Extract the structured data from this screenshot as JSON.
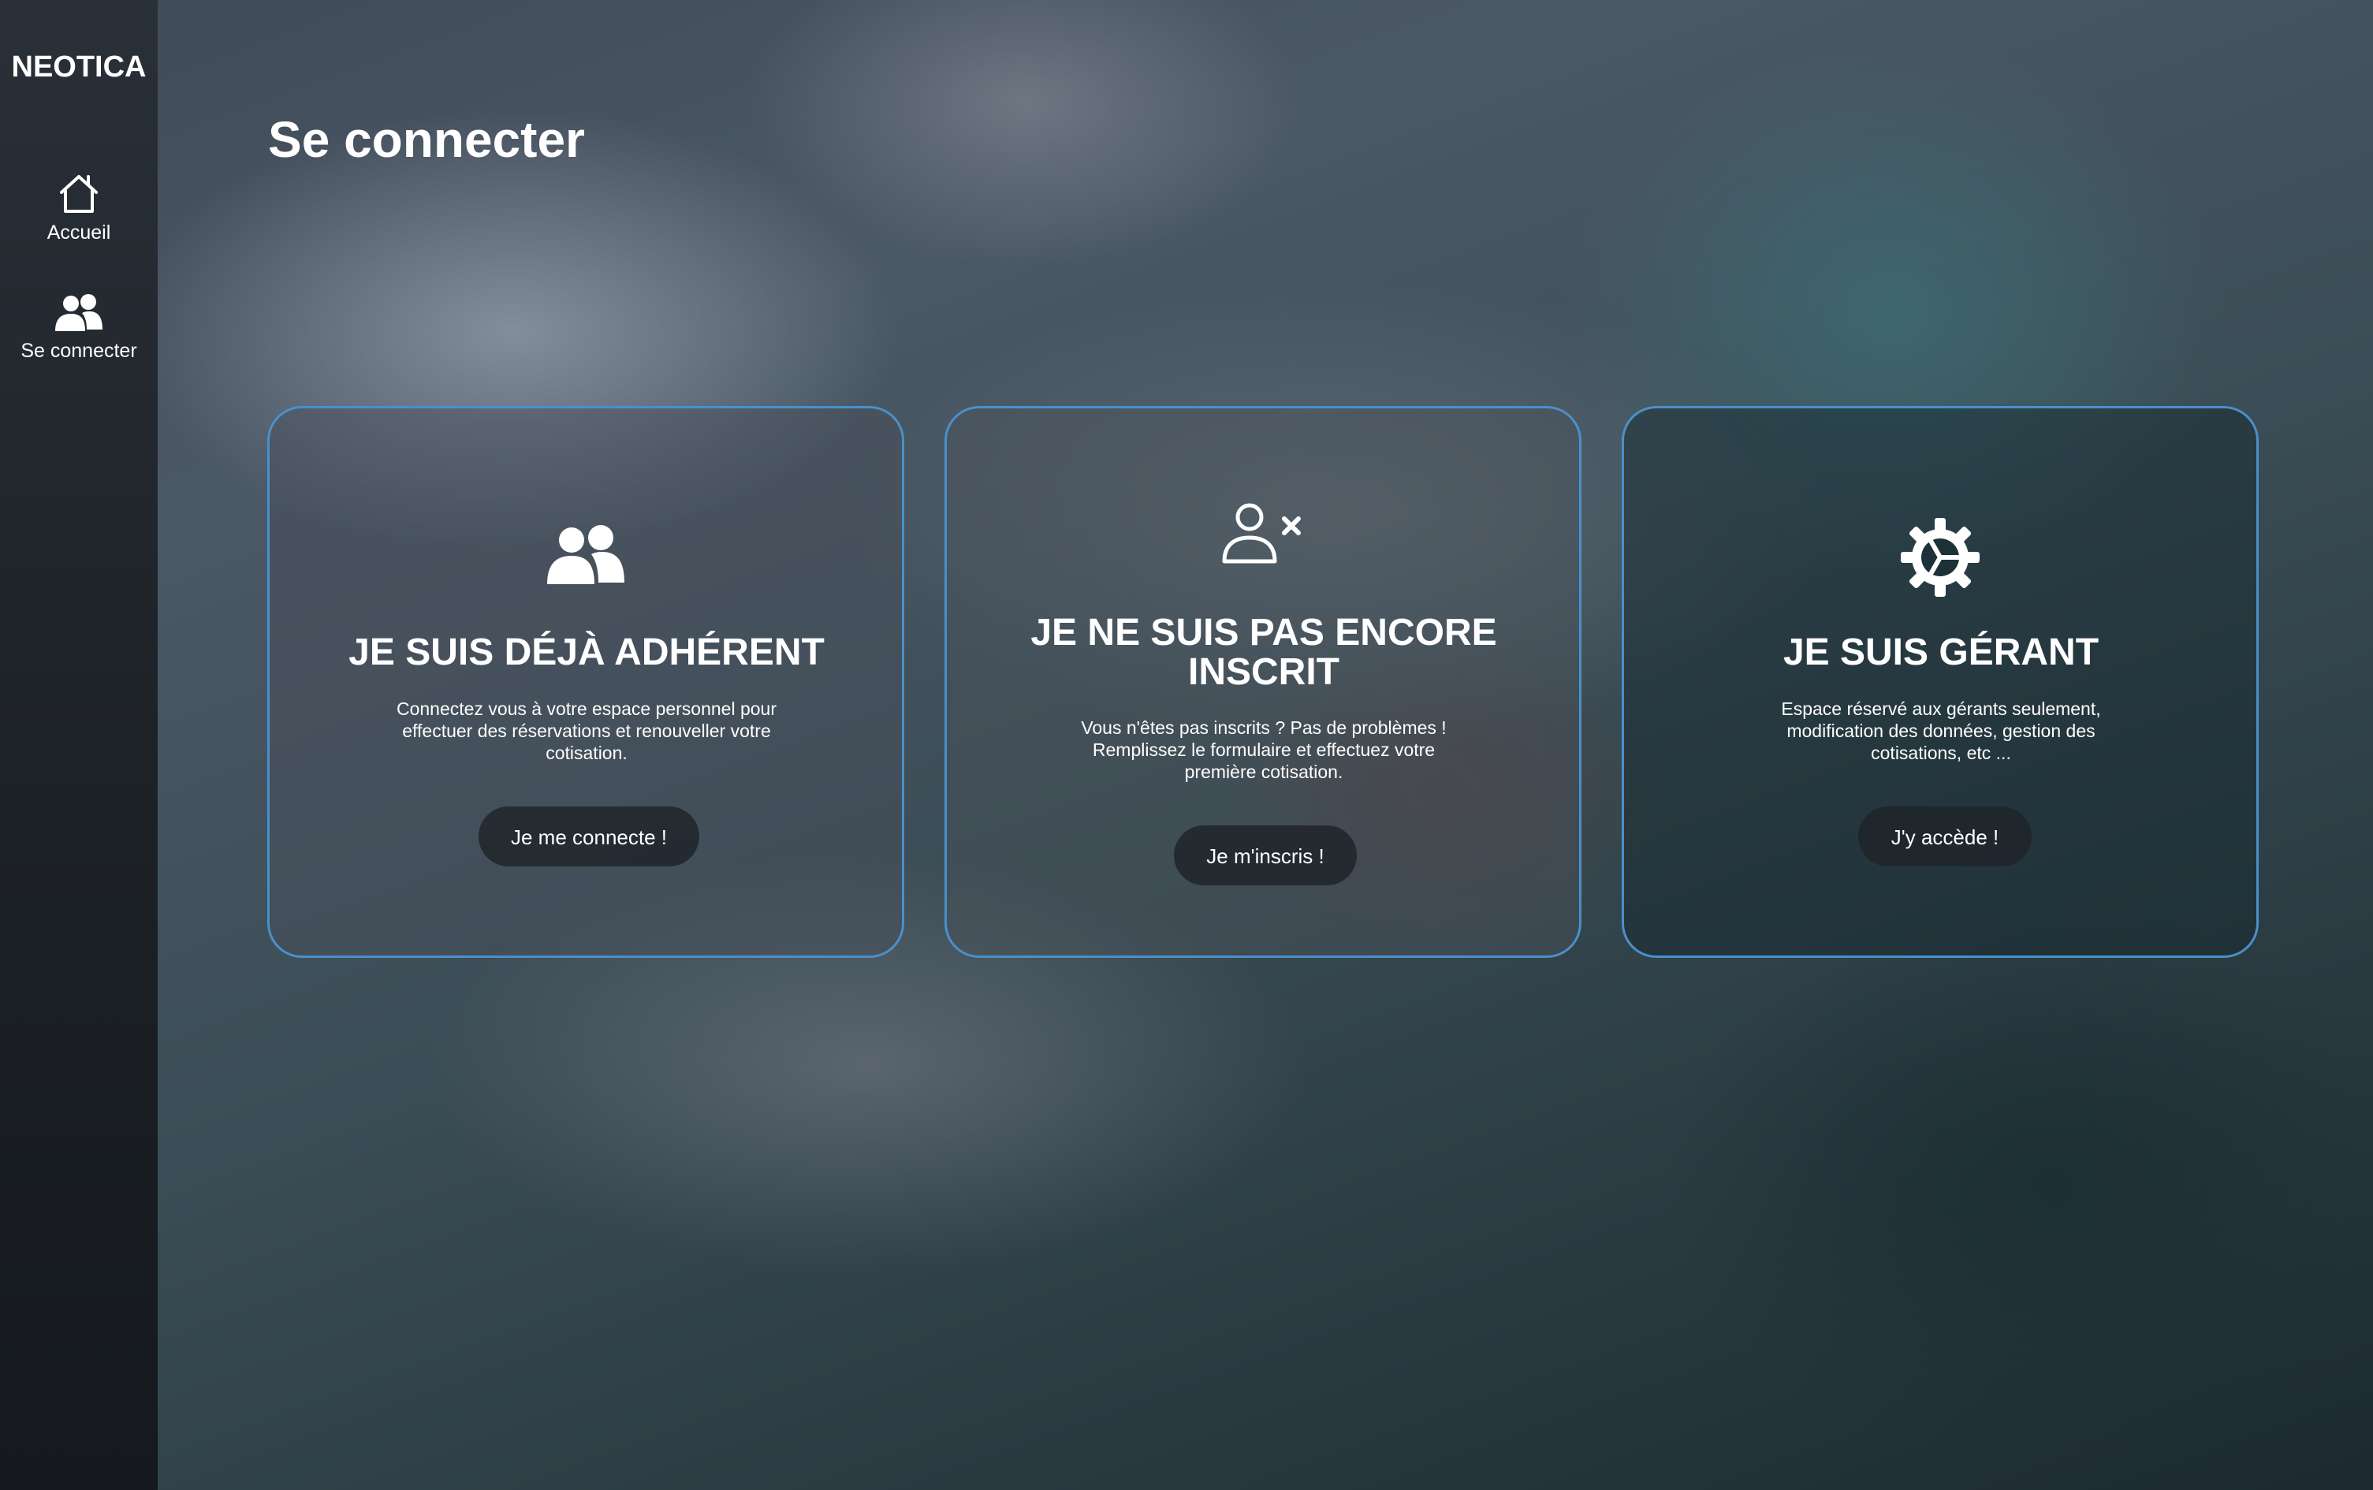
{
  "sidebar": {
    "brand": "NEOTICA",
    "items": [
      {
        "label": "Accueil",
        "icon": "home-icon"
      },
      {
        "label": "Se connecter",
        "icon": "users-icon"
      }
    ]
  },
  "main": {
    "title": "Se connecter",
    "cards": [
      {
        "icon": "users-icon",
        "title": "JE SUIS DÉJÀ ADHÉRENT",
        "description": "Connectez vous à votre espace personnel pour effectuer des réservations et renouveller votre cotisation.",
        "button": "Je me connecte !"
      },
      {
        "icon": "user-x-icon",
        "title": "JE NE SUIS PAS ENCORE INSCRIT",
        "description": "Vous n'êtes pas inscrits ? Pas de problèmes ! Remplissez le formulaire et effectuez votre première cotisation.",
        "button": "Je m'inscris !"
      },
      {
        "icon": "gear-icon",
        "title": "JE SUIS GÉRANT",
        "description": "Espace réservé aux gérants seulement, modification des données, gestion des cotisations, etc ...",
        "button": "J'y accède !"
      }
    ]
  },
  "colors": {
    "card_border": "#4a90c9",
    "sidebar_bg": "#1d2227",
    "button_bg": "#1e242a",
    "text": "#ffffff"
  }
}
